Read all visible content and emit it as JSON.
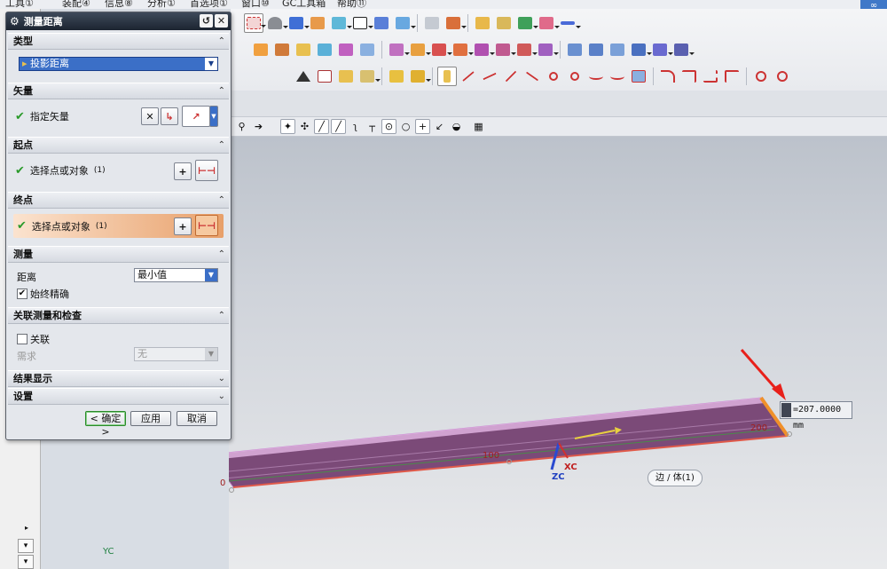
{
  "menu": {
    "items": [
      "工具①",
      "装配④",
      "信息⑧",
      "分析①",
      "首选项①",
      "窗口⑩",
      "GC工具箱",
      "帮助⑪"
    ]
  },
  "dialog": {
    "title": "测量距离",
    "sections": {
      "type": {
        "label": "类型",
        "select_value": "投影距离"
      },
      "vector": {
        "label": "矢量",
        "row_label": "指定矢量"
      },
      "start": {
        "label": "起点",
        "row_label": "选择点或对象",
        "count": "(1)"
      },
      "end": {
        "label": "终点",
        "row_label": "选择点或对象",
        "count": "(1)"
      },
      "measure": {
        "label": "测量",
        "distance_label": "距离",
        "distance_value": "最小值",
        "always_accurate_label": "始终精确",
        "always_accurate_checked": true
      },
      "assoc": {
        "label": "关联测量和检查",
        "assoc_label": "关联",
        "assoc_checked": false,
        "require_label": "需求",
        "require_value": "无"
      },
      "result": {
        "label": "结果显示"
      },
      "settings": {
        "label": "设置"
      }
    },
    "buttons": {
      "ok": "< 确定 >",
      "apply": "应用",
      "cancel": "取消"
    }
  },
  "viewport": {
    "measurement": "=207.0000 mm",
    "tooltip": "边 / 体(1)",
    "axes": {
      "xc": "XC",
      "zc": "ZC",
      "yc": "YC"
    },
    "tick_labels": {
      "zero": "0",
      "hundred": "100",
      "two_hundred": "200"
    }
  },
  "colors": {
    "dialog_bg": "#e4e7ec",
    "title_bar": "#1c2430",
    "active_row": "#e8a06a",
    "plate_fill": "#7b4a78",
    "plate_edge": "#e05a4a",
    "arrow": "#e8201a"
  }
}
